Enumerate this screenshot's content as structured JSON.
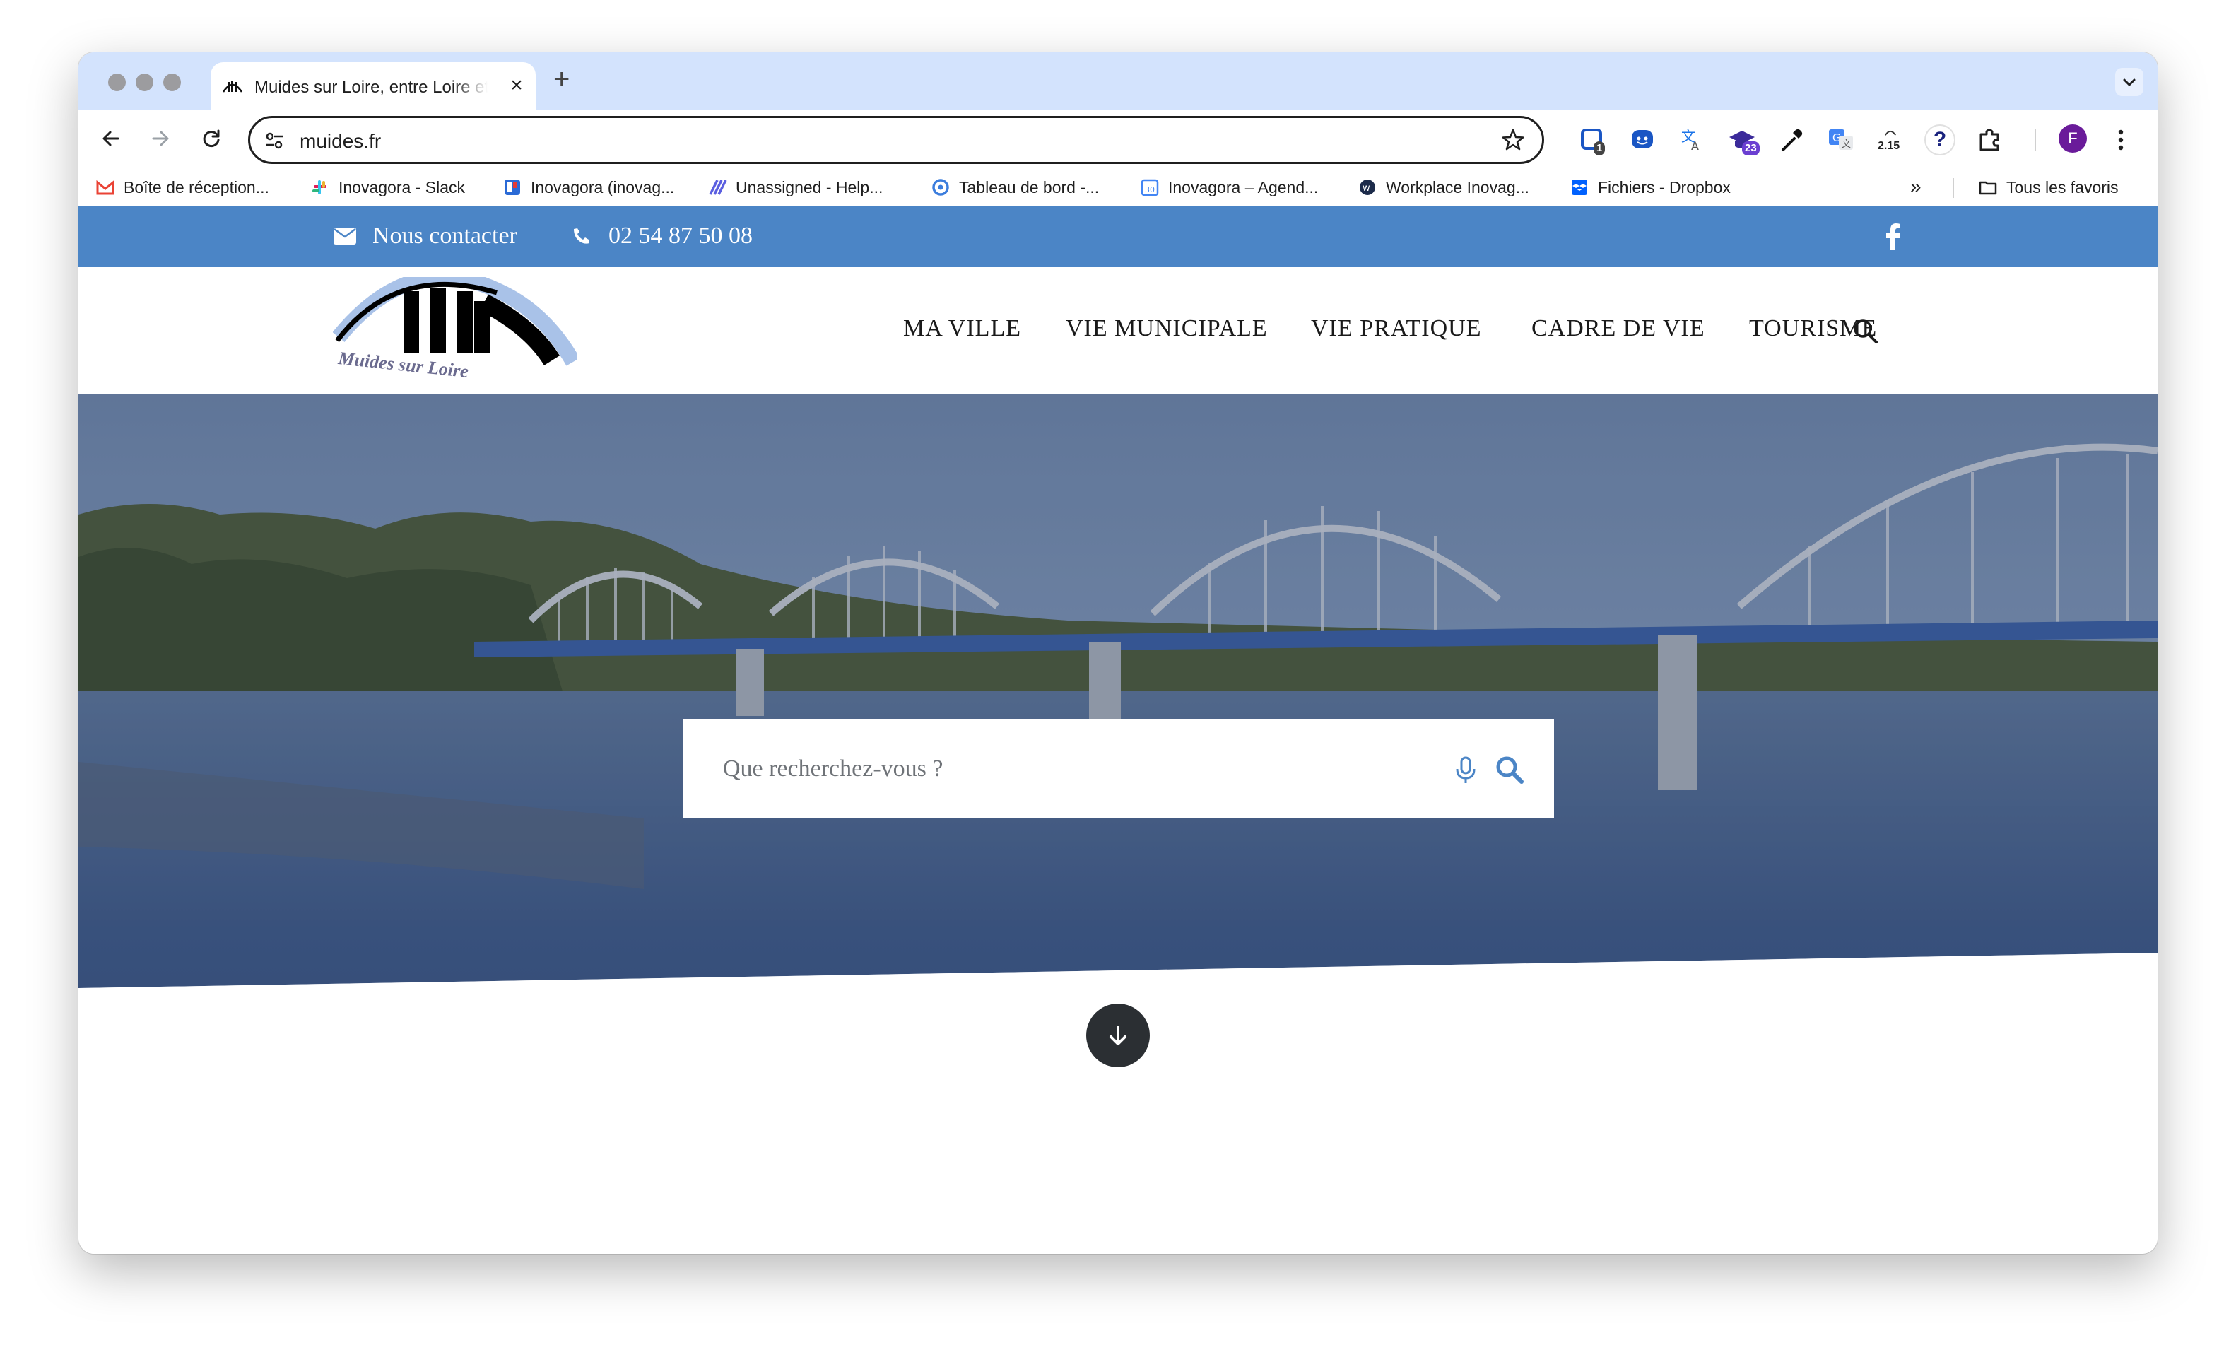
{
  "browser": {
    "tab": {
      "title": "Muides sur Loire, entre Loire et Chambord"
    },
    "address": {
      "url": "muides.fr"
    },
    "extensions": {
      "badge_one": "1",
      "badge_two": "23",
      "speed_label": "2.15"
    },
    "profile_initial": "F",
    "bookmarks": [
      {
        "label": "Boîte de réception...",
        "icon": "gmail-icon"
      },
      {
        "label": "Inovagora - Slack",
        "icon": "slack-icon"
      },
      {
        "label": "Inovagora (inovag...",
        "icon": "trello-icon"
      },
      {
        "label": "Unassigned - Help...",
        "icon": "helpdesk-icon"
      },
      {
        "label": "Tableau de bord -...",
        "icon": "dashboard-icon"
      },
      {
        "label": "Inovagora – Agend...",
        "icon": "calendar-icon"
      },
      {
        "label": "Workplace Inovag...",
        "icon": "workplace-icon"
      },
      {
        "label": "Fichiers - Dropbox",
        "icon": "dropbox-icon"
      }
    ],
    "all_bookmarks_label": "Tous les favoris"
  },
  "site": {
    "topbar": {
      "contact_label": "Nous contacter",
      "phone": "02 54 87 50 08"
    },
    "logo_text": "Muides sur Loire",
    "menu": [
      "MA VILLE",
      "VIE MUNICIPALE",
      "VIE PRATIQUE",
      "CADRE DE VIE",
      "TOURISME"
    ],
    "search": {
      "placeholder": "Que recherchez-vous ?"
    }
  },
  "colors": {
    "tabstrip": "#d3e3fd",
    "topbar": "#4b85c6",
    "search_icon": "#4b85c6",
    "scroll_button": "#2b2f33"
  }
}
